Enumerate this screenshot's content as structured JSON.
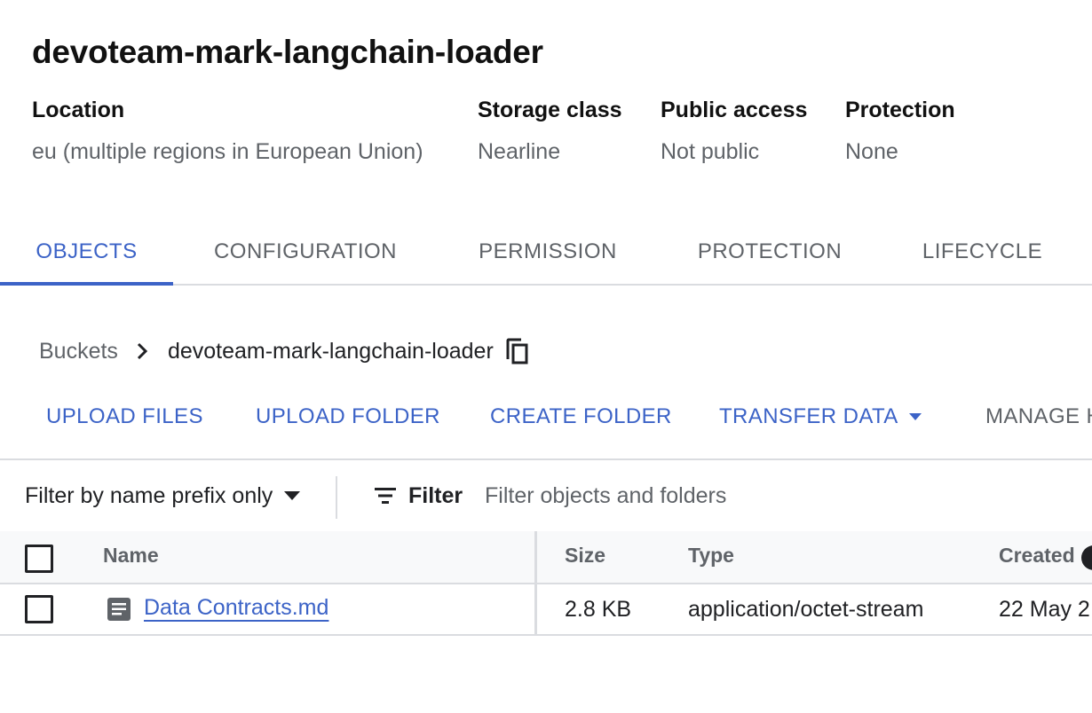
{
  "bucket": {
    "title": "devoteam-mark-langchain-loader"
  },
  "meta": [
    {
      "label": "Location",
      "value": "eu (multiple regions in European Union)"
    },
    {
      "label": "Storage class",
      "value": "Nearline"
    },
    {
      "label": "Public access",
      "value": "Not public"
    },
    {
      "label": "Protection",
      "value": "None"
    }
  ],
  "tabs": [
    {
      "label": "OBJECTS",
      "active": true
    },
    {
      "label": "CONFIGURATION",
      "active": false
    },
    {
      "label": "PERMISSION",
      "active": false
    },
    {
      "label": "PROTECTION",
      "active": false
    },
    {
      "label": "LIFECYCLE",
      "active": false
    }
  ],
  "breadcrumb": {
    "root": "Buckets",
    "current": "devoteam-mark-langchain-loader",
    "separator_icon": "chevron-right-icon",
    "copy_icon": "copy-icon"
  },
  "actions": [
    {
      "label": "UPLOAD FILES"
    },
    {
      "label": "UPLOAD FOLDER"
    },
    {
      "label": "CREATE FOLDER"
    },
    {
      "label": "TRANSFER DATA",
      "has_dropdown": true
    },
    {
      "label": "MANAGE H"
    }
  ],
  "filter": {
    "prefix_select": "Filter by name prefix only",
    "filter_label": "Filter",
    "placeholder": "Filter objects and folders"
  },
  "table": {
    "columns": [
      "Name",
      "Size",
      "Type",
      "Created"
    ],
    "rows": [
      {
        "name": "Data Contracts.md",
        "size": "2.8 KB",
        "type": "application/octet-stream",
        "created": "22 May 2"
      }
    ]
  },
  "colors": {
    "accent": "#3c63c7",
    "text": "#202124",
    "muted": "#5f6368",
    "border": "#dadce0"
  }
}
